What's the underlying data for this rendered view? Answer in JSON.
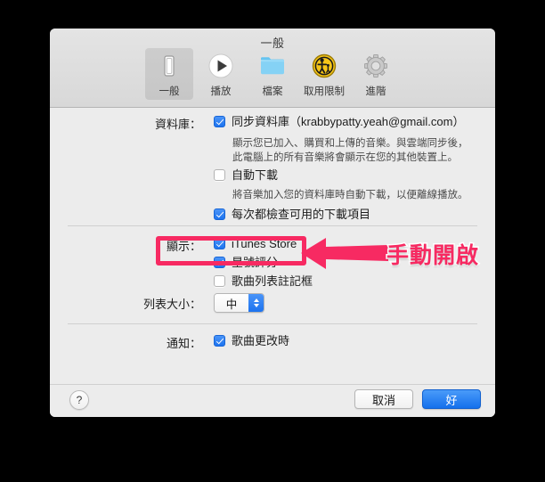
{
  "window": {
    "title": "一般"
  },
  "toolbar": {
    "tabs": [
      {
        "label": "一般",
        "icon": "device-icon",
        "selected": true
      },
      {
        "label": "播放",
        "icon": "play-icon",
        "selected": false
      },
      {
        "label": "檔案",
        "icon": "folder-icon",
        "selected": false
      },
      {
        "label": "取用限制",
        "icon": "parental-controls-icon",
        "selected": false
      },
      {
        "label": "進階",
        "icon": "gear-icon",
        "selected": false
      }
    ]
  },
  "sections": {
    "library": {
      "label": "資料庫：",
      "sync_checkbox": {
        "label": "同步資料庫（krabbypatty.yeah@gmail.com）",
        "checked": true
      },
      "sync_desc_line1": "顯示您已加入、購買和上傳的音樂。與雲端同步後，",
      "sync_desc_line2": "此電腦上的所有音樂將會顯示在您的其他裝置上。",
      "auto_download": {
        "label": "自動下載",
        "checked": false
      },
      "auto_download_desc": "將音樂加入您的資料庫時自動下載，以便離線播放。",
      "check_downloads": {
        "label": "每次都檢查可用的下載項目",
        "checked": true
      }
    },
    "display": {
      "label": "顯示：",
      "itunes_store": {
        "label": "iTunes Store",
        "checked": true
      },
      "star_rating": {
        "label": "星號評分",
        "checked": true
      },
      "song_list_checkbox": {
        "label": "歌曲列表註記框",
        "checked": false
      }
    },
    "list_size": {
      "label": "列表大小：",
      "value": "中"
    },
    "notification": {
      "label": "通知：",
      "song_changed": {
        "label": "歌曲更改時",
        "checked": true
      }
    }
  },
  "footer": {
    "help_label": "?",
    "cancel_label": "取消",
    "ok_label": "好"
  },
  "annotation": {
    "text": "手動開啟",
    "color": "#f72a62"
  }
}
